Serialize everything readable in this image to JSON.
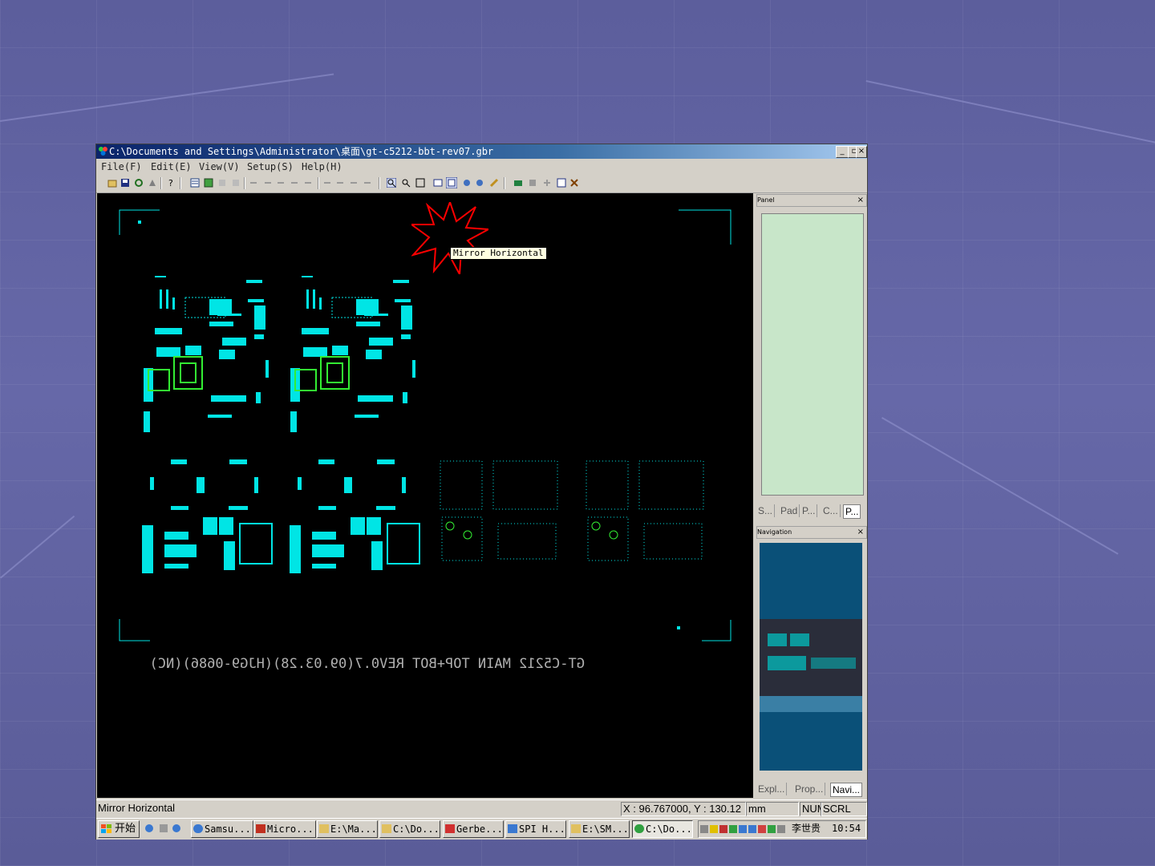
{
  "window": {
    "title": "C:\\Documents and Settings\\Administrator\\桌面\\gt-c5212-bbt-rev07.gbr",
    "buttons": {
      "minimize": "_",
      "maximize": "▫",
      "close": "×"
    }
  },
  "menu": {
    "items": [
      "File(F)",
      "Edit(E)",
      "View(V)",
      "Setup(S)",
      "Help(H)"
    ]
  },
  "toolbar": {
    "icons": [
      "open-icon",
      "save-icon",
      "refresh-icon",
      "clear-icon",
      "help-icon",
      "layer-icon",
      "edit-icon",
      "grid-icon",
      "zoom-in-icon",
      "zoom-out-icon",
      "fit-icon",
      "mirror-vertical-icon",
      "mirror-horizontal-icon",
      "rotate-left-icon",
      "rotate-right-icon",
      "ruler-icon",
      "pad-icon",
      "cross-icon",
      "export-icon",
      "settings-icon"
    ],
    "tooltip": "Mirror Horizontal",
    "highlight_color": "#ff0000"
  },
  "canvas": {
    "background": "#000000",
    "board_color": "#00e5e5",
    "highlight_pad_color": "#33ee33",
    "mirrored_label": "GT-C5212 MAIN TOP+BOT REV0.7(09.03.28)(HJG9-0686)(NC)"
  },
  "panel": {
    "title": "Panel",
    "close": "×",
    "tabs": [
      "S...",
      "Pad",
      "P...",
      "C...",
      "P..."
    ],
    "active_tab": 4,
    "body_color": "#c8e6c9"
  },
  "navigation": {
    "title": "Navigation",
    "close": "×",
    "tabs": [
      "Expl...",
      "Prop...",
      "Navi..."
    ],
    "active_tab": 2
  },
  "status": {
    "message": "Mirror Horizontal",
    "coords": "X : 96.767000, Y : 130.12",
    "unit": "mm",
    "num": "NUM",
    "scrl": "SCRL"
  },
  "taskbar": {
    "start": "开始",
    "tasks": [
      "Samsu...",
      "Micro...",
      "E:\\Ma...",
      "C:\\Do...",
      "Gerbe...",
      "SPI H...",
      "E:\\SM...",
      "C:\\Do..."
    ],
    "active_task": 7,
    "tray_user": "李世贵",
    "clock": "10:54"
  }
}
